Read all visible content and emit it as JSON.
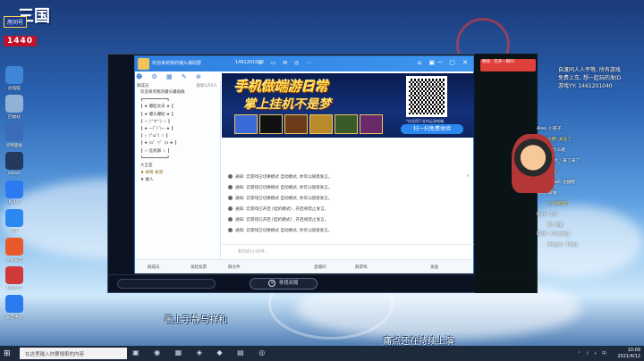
{
  "overlay": {
    "room_badge": "房间号",
    "room_number": "1440",
    "logo": "三国"
  },
  "desktop_icons": [
    {
      "label": "此电脑",
      "color": "#3f86d8"
    },
    {
      "label": "回收站",
      "color": "#8fb2d6"
    },
    {
      "label": "控制面板",
      "color": "#3b6cb8"
    },
    {
      "label": "Steam",
      "color": "#24395e"
    },
    {
      "label": "KOOK",
      "color": "#2b7af0"
    },
    {
      "label": "QQ",
      "color": "#2b88f0"
    },
    {
      "label": "火绒安全",
      "color": "#e85a2a"
    },
    {
      "label": "Legend",
      "color": "#d13a3a"
    },
    {
      "label": "安全中心",
      "color": "#2b7af0"
    }
  ],
  "qq": {
    "title": "欢迎来到我的撮头撮助群",
    "id": "1461201040",
    "sidebar_header": "群成员",
    "sidebar_header_right": "搜索1/50人",
    "sidebar_rows": [
      "欢迎来到我的撮头撮助群",
      "┏━━━━━━━━━━┓",
      "┃  ★  撮起太白  ★  ┃",
      "┃  ★  撮头撮助  ★  ┃",
      "┃  ☆  (^∀^)  ☆  ┃",
      "┃  ★  ~(‾▿‾)~  ★  ┃",
      "┃  ☆  (°ω°)  ☆  ┃",
      "┃  ★  (o゜▽゜)o  ★  ┃",
      "┃  ☆  挂机群  ☆  ┃",
      "┗━━━━━━━━━━┛",
      "大王室"
    ],
    "member_row": "帅哥 关羽",
    "member_row2": "群人",
    "banner": {
      "title1": "手机做端游日常",
      "title2": "掌上挂机不是梦",
      "qr_note": "*仅适用于支持云游戏端",
      "scan_btn": "扫一扫免费体验"
    },
    "messages": [
      {
        "text": "通知: 云游戏已切换模式 自动模式, 你可以随意发言。",
        "right": "✕"
      },
      {
        "text": "通知: 云游戏已切换模式 自动模式, 你可以随意发言。",
        "right": ""
      },
      {
        "text": "通知: 云游戏已切换模式 自动模式, 你可以随意发言。",
        "right": ""
      },
      {
        "text": "通知: 云游戏已开启 [挂机模式] , 开启将禁止发言。",
        "right": ""
      },
      {
        "text": "通知: 云游戏已开启 [挂机模式] , 开启将禁止发言。",
        "right": ""
      },
      {
        "text": "通知: 云游戏已切换模式 自动模式, 你可以随意发言。",
        "right": ""
      }
    ],
    "input_placeholder": "和你的小伙伴...",
    "footer": [
      "群成员",
      "发起投票",
      "群文件",
      "直播间",
      "群游戏",
      "发送"
    ]
  },
  "emulator": {
    "find_button": "寻找对局"
  },
  "stream": {
    "live_title": "晚场 · 花开一瞬间",
    "right_text": [
      "自渡同人人平等, 所有游戏",
      "免费上车, 想一起玩的发ID",
      "游戏YY: 1461201040"
    ],
    "danmu": [
      {
        "text": "Aise: 小孩子",
        "yellow": false
      },
      {
        "text": "小野: 关注了",
        "yellow": true
      },
      {
        "text": "小苗: 出什么呢",
        "yellow": false
      },
      {
        "text": "flash_: 来了来了",
        "yellow": false
      },
      {
        "text": "小猪: 上车",
        "yellow": true
      },
      {
        "text": "Cloud: 主播稳",
        "yellow": false
      },
      {
        "text": "青青: 加油",
        "yellow": false
      },
      {
        "text": "七: 好玩吗",
        "yellow": true
      },
      {
        "text": "Kuro: 上分",
        "yellow": false
      },
      {
        "text": "风: 看看",
        "yellow": false
      },
      {
        "text": "DOH - Crossing",
        "yellow": false
      },
      {
        "text": "dragon - Dogs",
        "yellow": false
      }
    ],
    "caption_left": "画上宇静与祥和",
    "caption_right": "痛点还在持续上演"
  },
  "taskbar": {
    "search_placeholder": "在这里输入你要搜索的内容",
    "time": "10:09",
    "date": "2021/4/12"
  }
}
